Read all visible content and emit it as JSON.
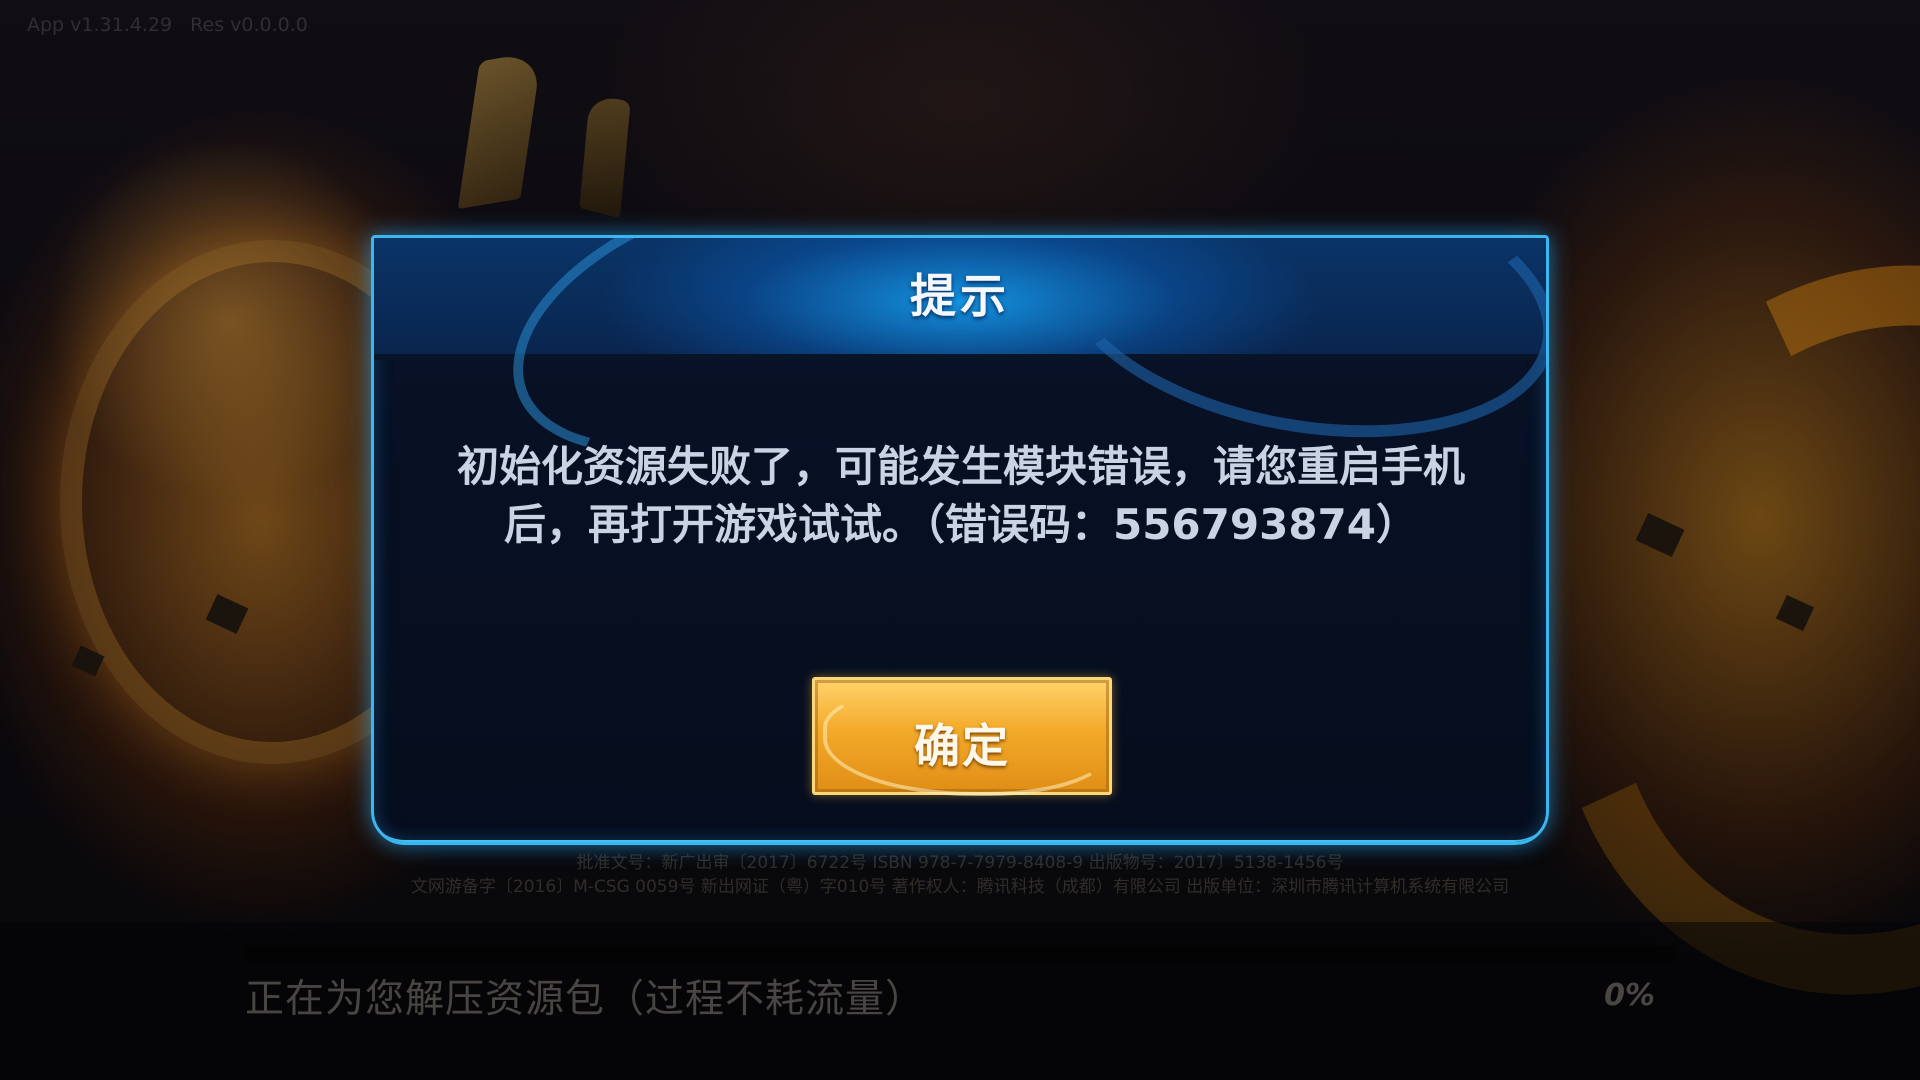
{
  "version": {
    "text": "App v1.31.4.29   Res v0.0.0.0"
  },
  "legal": {
    "line1": "批准文号：新广出审〔2017〕6722号  ISBN 978-7-7979-8408-9  出版物号：2017〕5138-1456号",
    "line2": "文网游备字〔2016〕M-CSG 0059号  新出网证（粤）字010号  著作权人：腾讯科技（成都）有限公司  出版单位：深圳市腾讯计算机系统有限公司"
  },
  "dialog": {
    "title": "提示",
    "message_line1": "初始化资源失败了，可能发生模块错误，请您重启手机",
    "message_line2_prefix": "后，再打开游戏试试。（错误码：",
    "error_code": "556793874",
    "message_line2_suffix": "）",
    "confirm_label": "确定"
  },
  "loading": {
    "status_text": "正在为您解压资源包（过程不耗流量）",
    "percent_text": "0%",
    "progress": 0
  },
  "colors": {
    "dialog_border": "#3bb7ee",
    "button_gold": "#f3aa2a",
    "background": "#07080c"
  }
}
